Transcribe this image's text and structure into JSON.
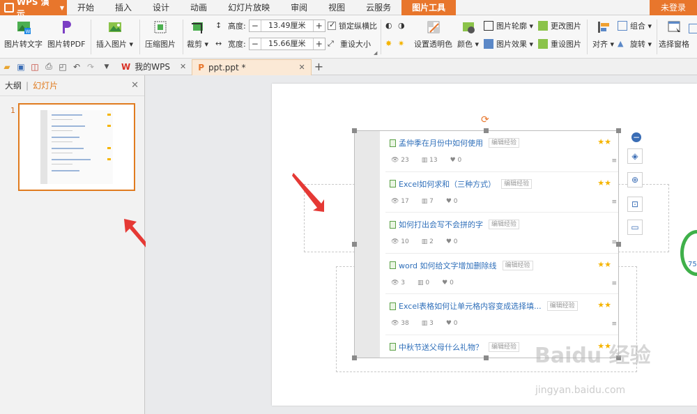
{
  "app": {
    "name": "WPS 演示",
    "login": "未登录"
  },
  "menu": [
    "开始",
    "插入",
    "设计",
    "动画",
    "幻灯片放映",
    "审阅",
    "视图",
    "云服务",
    "图片工具"
  ],
  "ribbon": {
    "pic_to_text": "图片转文字",
    "pic_to_pdf": "图片转PDF",
    "insert_pic": "插入图片",
    "compress_pic": "压缩图片",
    "crop": "裁剪",
    "height_label": "高度:",
    "height_value": "13.49厘米",
    "width_label": "宽度:",
    "width_value": "15.66厘米",
    "lock_ratio": "锁定纵横比",
    "reset_size": "重设大小",
    "set_transparent": "设置透明色",
    "color": "颜色",
    "pic_outline": "图片轮廓",
    "pic_effect": "图片效果",
    "change_pic": "更改图片",
    "reset_pic": "重设图片",
    "align": "对齐",
    "group": "组合",
    "rotate": "旋转",
    "select_pane": "选择窗格"
  },
  "tabs": {
    "mywps": "我的WPS",
    "doc": "ppt.ppt *"
  },
  "left_panel": {
    "outline": "大纲",
    "slides": "幻灯片",
    "slide_number": "1"
  },
  "image_list": [
    {
      "title": "孟仲季在月份中如何使用",
      "tag": "编辑经验",
      "views": "23",
      "likes": "13",
      "fav": "0"
    },
    {
      "title": "Excel如何求和（三种方式）",
      "tag": "编辑经验",
      "views": "17",
      "likes": "7",
      "fav": "0"
    },
    {
      "title": "如何打出会写不会拼的字",
      "tag": "编辑经验",
      "views": "10",
      "likes": "2",
      "fav": "0"
    },
    {
      "title": "word 如何给文字增加删除线",
      "tag": "编辑经验",
      "views": "3",
      "likes": "0",
      "fav": "0"
    },
    {
      "title": "Excel表格如何让单元格内容变成选择填...",
      "tag": "编辑经验",
      "views": "38",
      "likes": "3",
      "fav": "0"
    },
    {
      "title": "中秋节送父母什么礼物？",
      "tag": "编辑经验",
      "views": "",
      "likes": "",
      "fav": ""
    }
  ],
  "gauge_text": "75",
  "watermark": {
    "main": "Baidu 经验",
    "sub": "jingyan.baidu.com"
  },
  "colors": {
    "accent": "#e8762c",
    "link": "#2f6fba",
    "star": "#f5b400"
  }
}
